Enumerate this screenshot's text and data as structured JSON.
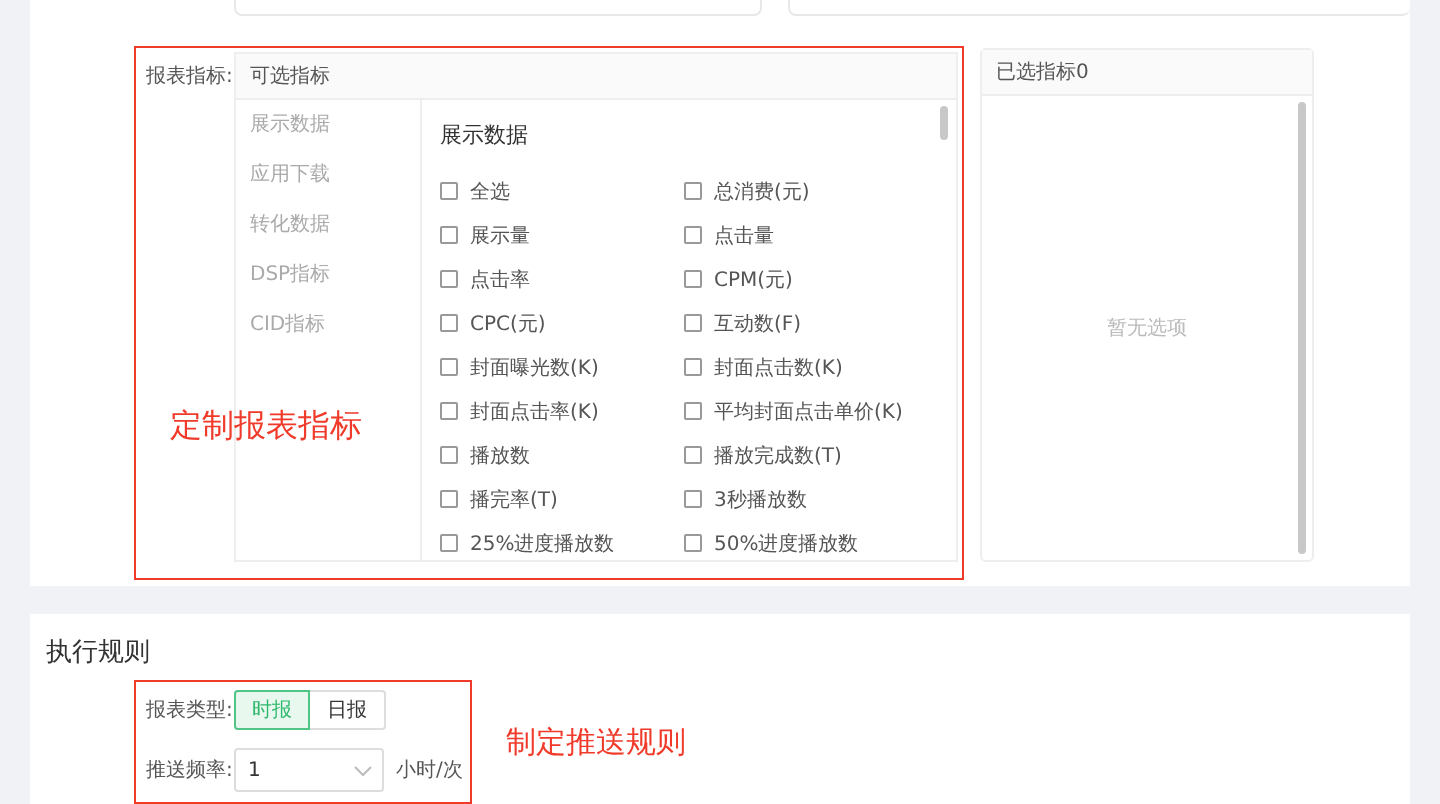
{
  "report_metrics": {
    "label": "报表指标:",
    "available": {
      "title": "可选指标",
      "categories": [
        {
          "label": "展示数据"
        },
        {
          "label": "应用下载"
        },
        {
          "label": "转化数据"
        },
        {
          "label": "DSP指标"
        },
        {
          "label": "CID指标"
        }
      ],
      "group_title": "展示数据",
      "metrics": [
        {
          "label": "全选",
          "checked": false
        },
        {
          "label": "总消费(元)",
          "checked": false
        },
        {
          "label": "展示量",
          "checked": false
        },
        {
          "label": "点击量",
          "checked": false
        },
        {
          "label": "点击率",
          "checked": false
        },
        {
          "label": "CPM(元)",
          "checked": false
        },
        {
          "label": "CPC(元)",
          "checked": false
        },
        {
          "label": "互动数(F)",
          "checked": false
        },
        {
          "label": "封面曝光数(K)",
          "checked": false
        },
        {
          "label": "封面点击数(K)",
          "checked": false
        },
        {
          "label": "封面点击率(K)",
          "checked": false
        },
        {
          "label": "平均封面点击单价(K)",
          "checked": false
        },
        {
          "label": "播放数",
          "checked": false
        },
        {
          "label": "播放完成数(T)",
          "checked": false
        },
        {
          "label": "播完率(T)",
          "checked": false
        },
        {
          "label": "3秒播放数",
          "checked": false
        },
        {
          "label": "25%进度播放数",
          "checked": false
        },
        {
          "label": "50%进度播放数",
          "checked": false
        }
      ]
    },
    "selected_panel": {
      "title": "已选指标0",
      "empty_text": "暂无选项"
    },
    "annotation": "定制报表指标"
  },
  "execution_rules": {
    "title": "执行规则",
    "report_type": {
      "label": "报表类型:",
      "options": [
        {
          "label": "时报",
          "selected": true
        },
        {
          "label": "日报",
          "selected": false
        }
      ]
    },
    "frequency": {
      "label": "推送频率:",
      "value": "1",
      "unit": "小时/次"
    },
    "annotation": "制定推送规则"
  }
}
